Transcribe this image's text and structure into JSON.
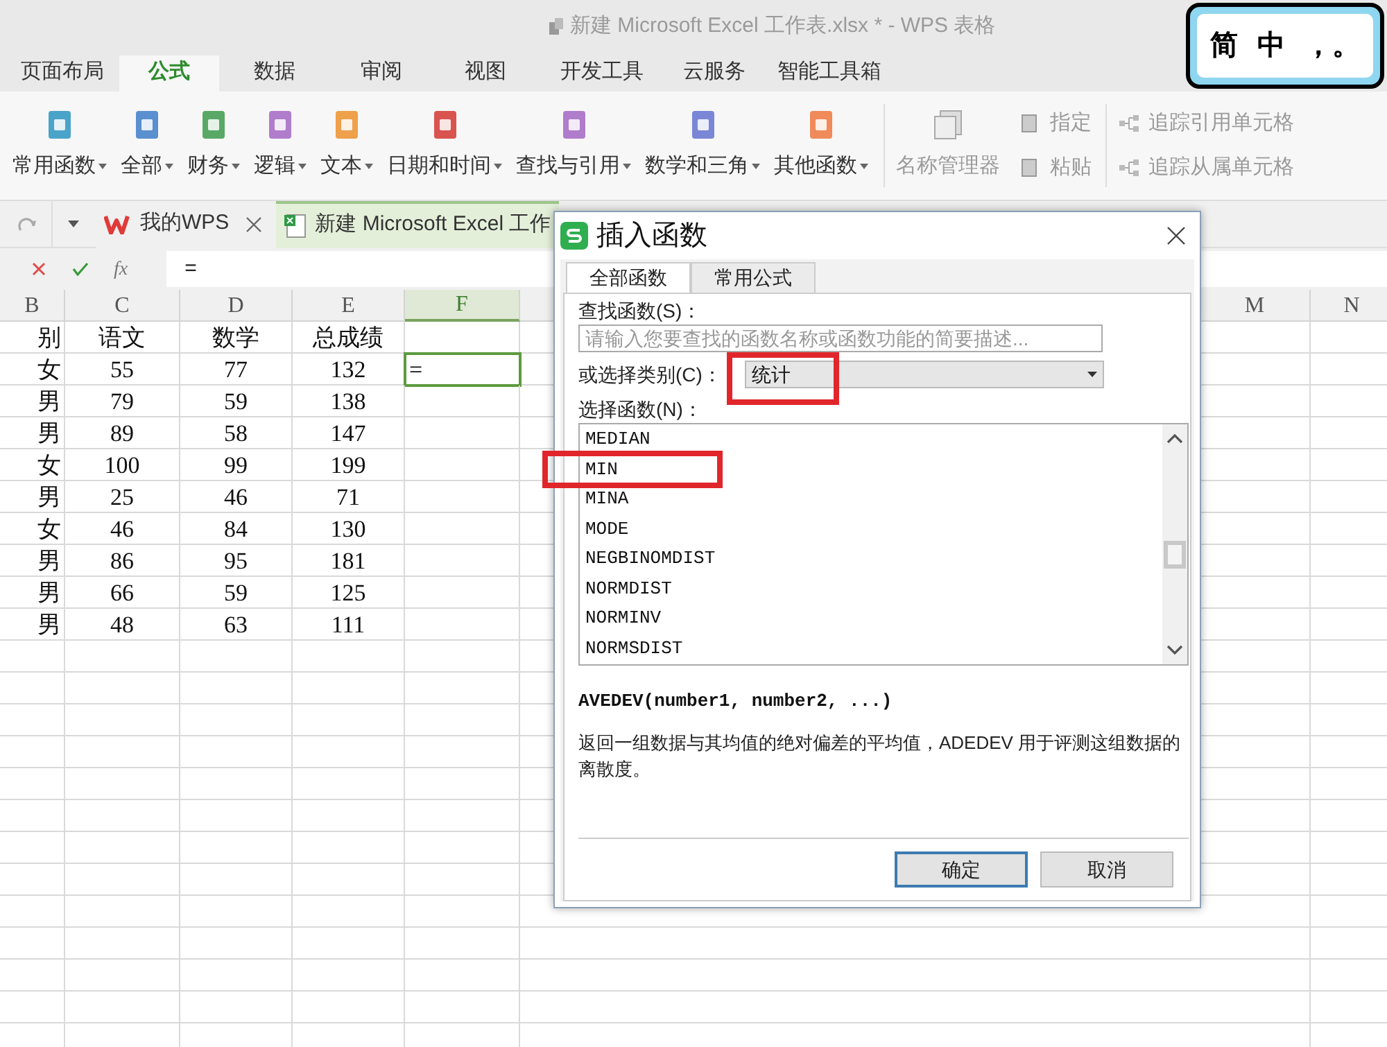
{
  "window": {
    "title": "新建 Microsoft Excel 工作表.xlsx * - WPS 表格"
  },
  "ime_indicator": {
    "items": [
      "简",
      "中",
      "，。"
    ]
  },
  "ribbon_tabs": [
    {
      "label": "页面布局",
      "selected": false
    },
    {
      "label": "公式",
      "selected": true
    },
    {
      "label": "数据",
      "selected": false
    },
    {
      "label": "审阅",
      "selected": false
    },
    {
      "label": "视图",
      "selected": false
    },
    {
      "label": "开发工具",
      "selected": false
    },
    {
      "label": "云服务",
      "selected": false
    },
    {
      "label": "智能工具箱",
      "selected": false
    }
  ],
  "ribbon": {
    "function_groups": [
      {
        "label": "常用函数",
        "color": "#4aa3c8"
      },
      {
        "label": "全部",
        "color": "#5a8fd0"
      },
      {
        "label": "财务",
        "color": "#5aa866"
      },
      {
        "label": "逻辑",
        "color": "#b07ccc"
      },
      {
        "label": "文本",
        "color": "#eea04a"
      },
      {
        "label": "日期和时间",
        "color": "#d9534f"
      },
      {
        "label": "查找与引用",
        "color": "#b07ccc"
      },
      {
        "label": "数学和三角",
        "color": "#7a86d6"
      },
      {
        "label": "其他函数",
        "color": "#f08a5a"
      }
    ],
    "name_manager": {
      "label": "名称管理器",
      "disabled": true
    },
    "small_buttons": [
      {
        "label": "指定",
        "disabled": true
      },
      {
        "label": "粘贴",
        "disabled": true
      }
    ],
    "trace_buttons": [
      {
        "label": "追踪引用单元格",
        "disabled": true
      },
      {
        "label": "追踪从属单元格",
        "disabled": true
      }
    ]
  },
  "document_tabs": [
    {
      "label": "我的WPS",
      "kind": "home",
      "selected": false
    },
    {
      "label": "新建 Microsoft Excel 工作",
      "kind": "sheet",
      "selected": true
    }
  ],
  "formula_bar": {
    "function_label": "fx",
    "value": "="
  },
  "sheet": {
    "columns": [
      {
        "label": "B",
        "selected": false
      },
      {
        "label": "C",
        "selected": false
      },
      {
        "label": "D",
        "selected": false
      },
      {
        "label": "E",
        "selected": false
      },
      {
        "label": "F",
        "selected": true
      },
      {
        "label": "M",
        "selected": false
      },
      {
        "label": "N",
        "selected": false
      }
    ],
    "rows": [
      [
        "别",
        "语文",
        "数学",
        "总成绩",
        ""
      ],
      [
        "女",
        "55",
        "77",
        "132",
        {
          "value": "=",
          "active": true
        }
      ],
      [
        "男",
        "79",
        "59",
        "138",
        ""
      ],
      [
        "男",
        "89",
        "58",
        "147",
        ""
      ],
      [
        "女",
        "100",
        "99",
        "199",
        ""
      ],
      [
        "男",
        "25",
        "46",
        "71",
        ""
      ],
      [
        "女",
        "46",
        "84",
        "130",
        ""
      ],
      [
        "男",
        "86",
        "95",
        "181",
        ""
      ],
      [
        "男",
        "66",
        "59",
        "125",
        ""
      ],
      [
        "男",
        "48",
        "63",
        "111",
        ""
      ]
    ]
  },
  "dialog": {
    "title": "插入函数",
    "tabs": [
      {
        "label": "全部函数",
        "selected": true
      },
      {
        "label": "常用公式",
        "selected": false
      }
    ],
    "search_label": "查找函数(S)：",
    "search_placeholder": "请输入您要查找的函数名称或函数功能的简要描述...",
    "category_label": "或选择类别(C)：",
    "category_value": "统计",
    "list_label": "选择函数(N)：",
    "functions": [
      {
        "name": "MEDIAN",
        "selected": false
      },
      {
        "name": "MIN",
        "selected": false
      },
      {
        "name": "MINA",
        "selected": false
      },
      {
        "name": "MODE",
        "selected": false
      },
      {
        "name": "NEGBINOMDIST",
        "selected": false
      },
      {
        "name": "NORMDIST",
        "selected": false
      },
      {
        "name": "NORMINV",
        "selected": false
      },
      {
        "name": "NORMSDIST",
        "selected": false
      }
    ],
    "signature": "AVEDEV(number1, number2, ...)",
    "description": "返回一组数据与其均值的绝对偏差的平均值，ADEDEV 用于评测这组数据的离散度。",
    "buttons": [
      {
        "label": "确定",
        "kind": "primary"
      },
      {
        "label": "取消",
        "kind": "secondary"
      }
    ]
  }
}
